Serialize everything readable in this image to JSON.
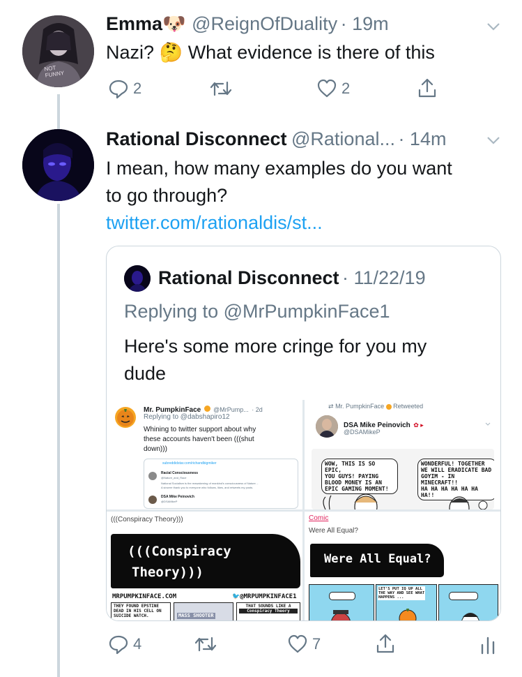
{
  "tweet1": {
    "name": "Emma",
    "name_emoji": "🐶",
    "handle": "@ReignOfDuality",
    "time": "· 19m",
    "text_before": "Nazi?",
    "emoji": "🤔",
    "text_after": "What evidence is there of this",
    "avatar_text": "NOT FUNNY",
    "replies": "2",
    "likes": "2"
  },
  "tweet2": {
    "name": "Rational Disconnect",
    "handle": "@Rational...",
    "time": "· 14m",
    "text_line1": "I mean, how many examples do you want",
    "text_line2": "to go through?",
    "link": "twitter.com/rationaldis/st...",
    "replies": "4",
    "likes": "7"
  },
  "quote": {
    "name": "Rational Disconnect",
    "date": "· 11/22/19",
    "replying": "Replying to @MrPumpkinFace1",
    "text_line1": "Here's some more cringe for you my",
    "text_line2": "dude"
  },
  "media1": {
    "name": "Mr. PumpkinFace",
    "handle": "@MrPump...",
    "time": "· 2d",
    "replying": "Replying to @dabshapiro12",
    "text1": "Whining to twitter support about why",
    "text2": "these accounts haven't been (((shut",
    "text3": "down)))",
    "inner_link": "subreddidstar.com/richandbigmiker",
    "inner_name": "Racial Consciousness",
    "inner_handle": "@Nature_and_Race",
    "inner_text1": "National Socialism is the reawakening of mankind's consciousness of Nature. -",
    "inner_text2": "A sincere thank you to everyone who follows, likes, and retweets my posts.",
    "inner_name2": "DSA Mike Peinovich",
    "inner_handle2": "@DSAMikeP"
  },
  "media2": {
    "retweeted": "Mr. PumpkinFace",
    "retweeted_suffix": "Retweeted",
    "name": "DSA Mike Peinovich",
    "handle": "@DSAMikeP",
    "bubble1_l1": "WOW, THIS IS SO EPIC,",
    "bubble1_l2": "YOU GUYS! PAYING",
    "bubble1_l3": "BLOOD MONEY IS AN",
    "bubble1_l4": "EPIC GAMING MOMENT!",
    "bubble2_l1": "WONDERFUL! TOGETHER",
    "bubble2_l2": "WE WILL ERADICATE BAD",
    "bubble2_l3": "GOYIM - IN MINECRAFT!!",
    "bubble2_l4": "HA HA HA HA HA HA HA!!"
  },
  "media3": {
    "header": "(((Conspiracy Theory)))",
    "banner_l1": "(((Conspiracy",
    "banner_l2": "Theory)))",
    "site": "MRPUMPKINFACE.COM",
    "twitter": "@MRPUMPKINFACE1",
    "panel1_l1": "THEY FOUND EPSTINE",
    "panel1_l2": "DEAD IN HIS CELL ON",
    "panel1_l3": "SUICIDE WATCH.",
    "panel2": "MASS SHOOTER",
    "panel3_l1": "THAT SOUNDS LIKE A",
    "panel3_l2": "Conspiracy Theory"
  },
  "media4": {
    "tag": "Comic",
    "header": "Were All Equal?",
    "banner": "Were All Equal?",
    "panel_l1": "LET'S PUT IQ UP ALL",
    "panel_l2": "THE WAY AND SEE WHAT",
    "panel_l3": "HAPPENS ..."
  },
  "colors": {
    "link": "#1da1f2",
    "meta": "#657786",
    "border": "#ccd6dd"
  }
}
